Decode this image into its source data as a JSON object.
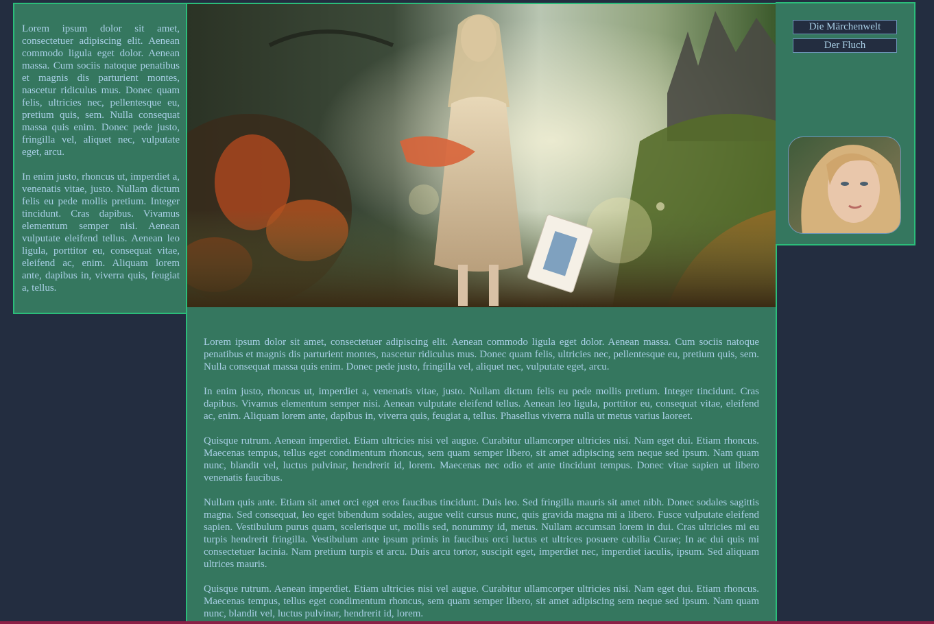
{
  "nav": {
    "items": [
      {
        "label": "Die Märchenwelt"
      },
      {
        "label": "Der Fluch"
      }
    ]
  },
  "sidebar": {
    "paragraphs": [
      "Lorem ipsum dolor sit amet, consectetuer adipiscing elit. Aenean commodo ligula eget dolor. Aenean massa. Cum sociis natoque penatibus et magnis dis parturient montes, nascetur ridiculus mus. Donec quam felis, ultricies nec, pellentesque eu, pretium quis, sem. Nulla consequat massa quis enim. Donec pede justo, fringilla vel, aliquet nec, vulputate eget, arcu.",
      "In enim justo, rhoncus ut, imperdiet a, venenatis vitae, justo. Nullam dictum felis eu pede mollis pretium. Integer tincidunt. Cras dapibus. Vivamus elementum semper nisi. Aenean vulputate eleifend tellus. Aenean leo ligula, porttitor eu, consequat vitae, eleifend ac, enim. Aliquam lorem ante, dapibus in, viverra quis, feugiat a, tellus."
    ]
  },
  "main": {
    "paragraphs": [
      "Lorem ipsum dolor sit amet, consectetuer adipiscing elit. Aenean commodo ligula eget dolor. Aenean massa. Cum sociis natoque penatibus et magnis dis parturient montes, nascetur ridiculus mus. Donec quam felis, ultricies nec, pellentesque eu, pretium quis, sem. Nulla consequat massa quis enim. Donec pede justo, fringilla vel, aliquet nec, vulputate eget, arcu.",
      "In enim justo, rhoncus ut, imperdiet a, venenatis vitae, justo. Nullam dictum felis eu pede mollis pretium. Integer tincidunt. Cras dapibus. Vivamus elementum semper nisi. Aenean vulputate eleifend tellus. Aenean leo ligula, porttitor eu, consequat vitae, eleifend ac, enim. Aliquam lorem ante, dapibus in, viverra quis, feugiat a, tellus. Phasellus viverra nulla ut metus varius laoreet.",
      "Quisque rutrum. Aenean imperdiet. Etiam ultricies nisi vel augue. Curabitur ullamcorper ultricies nisi. Nam eget dui. Etiam rhoncus. Maecenas tempus, tellus eget condimentum rhoncus, sem quam semper libero, sit amet adipiscing sem neque sed ipsum. Nam quam nunc, blandit vel, luctus pulvinar, hendrerit id, lorem. Maecenas nec odio et ante tincidunt tempus. Donec vitae sapien ut libero venenatis faucibus.",
      "Nullam quis ante. Etiam sit amet orci eget eros faucibus tincidunt. Duis leo. Sed fringilla mauris sit amet nibh. Donec sodales sagittis magna. Sed consequat, leo eget bibendum sodales, augue velit cursus nunc, quis gravida magna mi a libero. Fusce vulputate eleifend sapien. Vestibulum purus quam, scelerisque ut, mollis sed, nonummy id, metus. Nullam accumsan lorem in dui. Cras ultricies mi eu turpis hendrerit fringilla. Vestibulum ante ipsum primis in faucibus orci luctus et ultrices posuere cubilia Curae; In ac dui quis mi consectetuer lacinia. Nam pretium turpis et arcu. Duis arcu tortor, suscipit eget, imperdiet nec, imperdiet iaculis, ipsum. Sed aliquam ultrices mauris.",
      "Quisque rutrum. Aenean imperdiet. Etiam ultricies nisi vel augue. Curabitur ullamcorper ultricies nisi. Nam eget dui. Etiam rhoncus. Maecenas tempus, tellus eget condimentum rhoncus, sem quam semper libero, sit amet adipiscing sem neque sed ipsum. Nam quam nunc, blandit vel, luctus pulvinar, hendrerit id, lorem."
    ]
  },
  "colors": {
    "background": "#232d40",
    "panel": "#35775f",
    "panel_border": "#2bbd7a",
    "text": "#a9cfe6",
    "nav_border": "#6d95b9",
    "bottom_bar": "#8d1f46"
  },
  "images": {
    "banner": "fairy-tale-banner-image",
    "avatar": "portrait-avatar-image"
  }
}
